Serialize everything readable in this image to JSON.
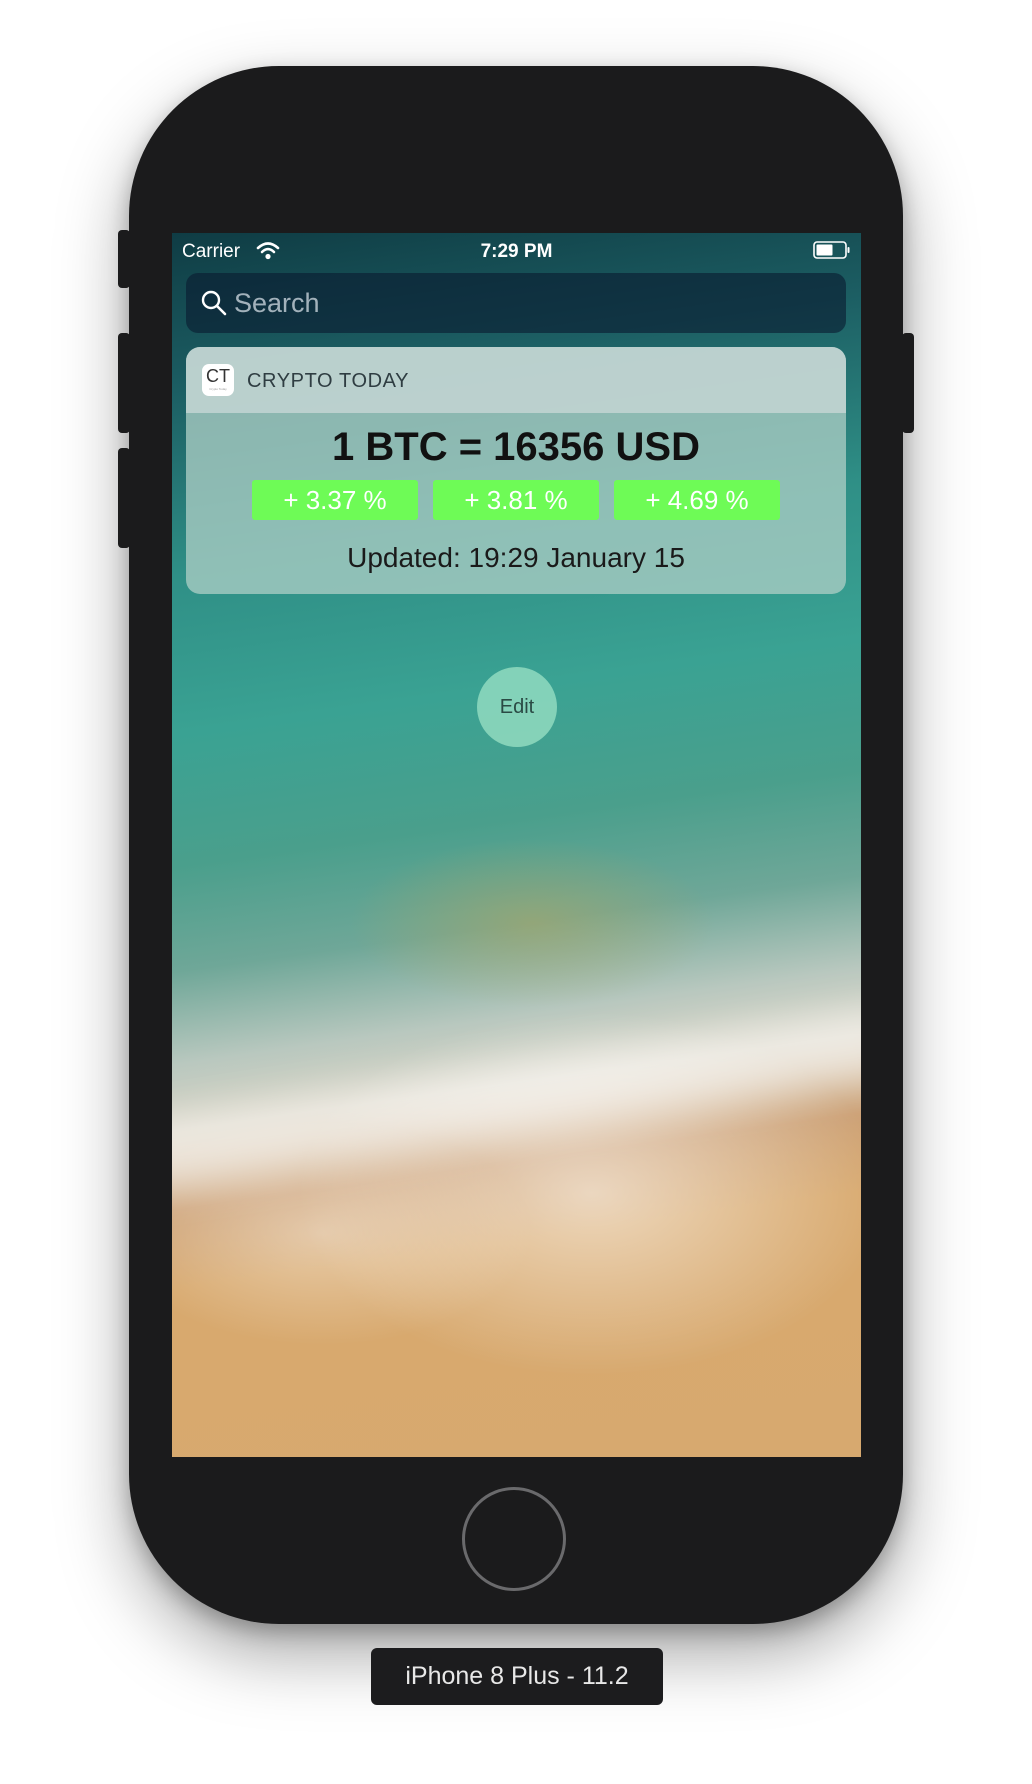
{
  "status_bar": {
    "carrier": "Carrier",
    "time": "7:29 PM",
    "wifi_icon": "wifi-icon",
    "battery_icon": "battery-icon"
  },
  "search": {
    "placeholder": "Search",
    "icon": "search-icon"
  },
  "widget": {
    "app_icon_text": "CT",
    "app_icon_subtext": "Crypto Today",
    "app_name": "CRYPTO TODAY",
    "price": "1 BTC = 16356 USD",
    "changes": [
      "+ 3.37 %",
      "+ 3.81 %",
      "+ 4.69 %"
    ],
    "updated": "Updated: 19:29 January 15",
    "change_color": "#6efb56"
  },
  "edit_button": {
    "label": "Edit"
  },
  "simulator": {
    "device_label": "iPhone 8 Plus - 11.2"
  }
}
